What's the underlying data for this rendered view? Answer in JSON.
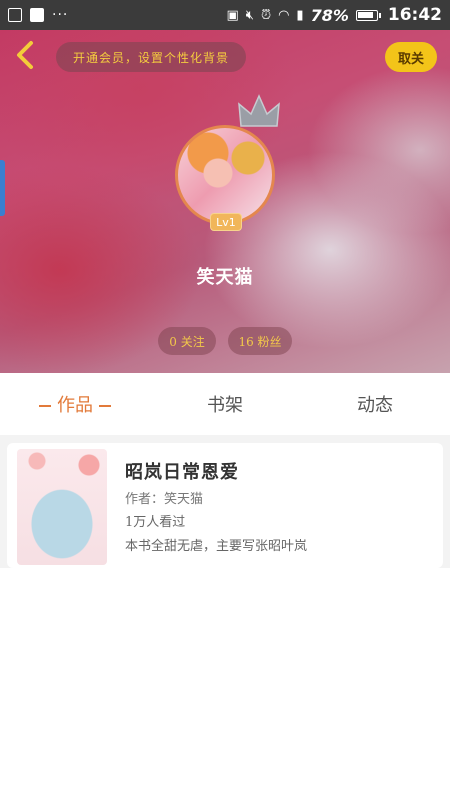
{
  "status_bar": {
    "dots": "···",
    "battery": "78%",
    "time": "16:42"
  },
  "header": {
    "vip_banner": "开通会员，设置个性化背景",
    "cancel_label": "取关",
    "username": "笑天猫",
    "level": "Lv1",
    "follow_label": "0 关注",
    "fans_label": "16 粉丝"
  },
  "tabs": [
    {
      "label": "作品",
      "active": true
    },
    {
      "label": "书架",
      "active": false
    },
    {
      "label": "动态",
      "active": false
    }
  ],
  "book": {
    "title": "昭岚日常恩爱",
    "author": "作者：笑天猫",
    "reads": "1万人看过",
    "description": "本书全甜无虐，主要写张昭叶岚"
  },
  "colors": {
    "accent": "#e27a3a",
    "gold": "#f3c419"
  }
}
